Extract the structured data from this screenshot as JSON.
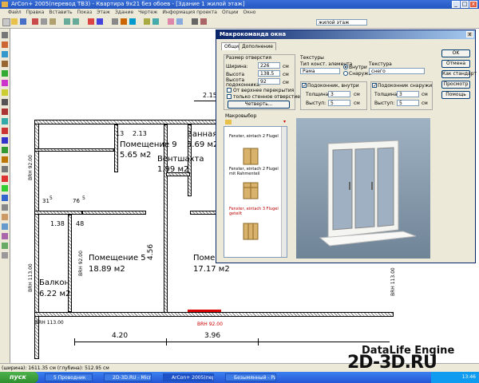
{
  "window": {
    "title": "ArCon+ 2005(перевод TB3) - Квартира 9х21 без обоев - [Здание 1 жилой этаж]"
  },
  "menu": [
    "Файл",
    "Правка",
    "Вставить",
    "Показ",
    "Этаж",
    "Здание",
    "Чертеж",
    "Информация проекта",
    "Опции",
    "Окно"
  ],
  "toolbar": {
    "floor_select": "жилой этаж"
  },
  "plan": {
    "rooms": [
      {
        "name": "Помещение 9",
        "area": "5.65 м2"
      },
      {
        "name": "Ванная",
        "area": "5.69 м2"
      },
      {
        "name": "Вентшахта",
        "area": "1.99 м2"
      },
      {
        "name": "Помещение 5",
        "area": "18.89 м2"
      },
      {
        "name": "Помеще",
        "area": "17.17 м2"
      },
      {
        "name": "Балкон",
        "area": "6.22 м2"
      }
    ],
    "dims": {
      "d215": "2.15",
      "d213": "2.13",
      "d13": "13",
      "d76": "76",
      "d5": "5",
      "d31": "31",
      "d138": "1.38",
      "d48": "48",
      "d456": "4.56",
      "d420": "4.20",
      "d396": "3.96"
    },
    "labels": {
      "brh_top": "BRH 92.00",
      "brh_left": "BRH 113.00",
      "brh_bottom": "BRH 113.00",
      "brh_mid": "BRH 92.00",
      "brh_mid2": "BRH 92.00",
      "brh_right": "BRH 113.00"
    }
  },
  "dialog": {
    "title": "Макрокоманда окна",
    "tabs": [
      "Общие",
      "Дополнение"
    ],
    "size_group": {
      "title": "Размер отверстия",
      "width_label": "Ширина:",
      "width_value": "226",
      "width_unit": "см",
      "height_label": "Высота",
      "height_value": "138.5",
      "height_unit": "см",
      "sill_label": "Высота подоконника:",
      "sill_value": "92",
      "sill_unit": "см",
      "check1": "От верхнее перекрытия",
      "check2": "только стенное отверстие",
      "quarter_button": "Четверть..."
    },
    "textures": {
      "title": "Текстуры",
      "elem_label": "Тип конст. элемента",
      "elem_value": "Рама",
      "inside": "Внутри",
      "outside": "Снаружи",
      "texture_label": "Текстура",
      "texture_value": "снего"
    },
    "sill_inside": {
      "label": "Подоконник, внутри",
      "thickness_label": "Толщина:",
      "thickness": "3",
      "thickness_unit": "см",
      "protrusion_label": "Выступ:",
      "protrusion": "5",
      "protrusion_unit": "см"
    },
    "sill_outside": {
      "label": "Подоконник снаружи",
      "thickness_label": "Толщина:",
      "thickness": "3",
      "thickness_unit": "см",
      "protrusion_label": "Выступ:",
      "protrusion": "5",
      "protrusion_unit": "см"
    },
    "buttons": {
      "ok": "OK",
      "cancel": "Отмена",
      "as_standard": "Как стандарт",
      "preview": "Просмотр",
      "help": "Помощь"
    },
    "macro": {
      "title": "Макровыбор",
      "items": [
        "Fenster, eintach 2 Flugel",
        "Fenster, eintach 2 Flugel mit Rahmenteil",
        "Fenster, eintach 3 Flugel geteilt"
      ]
    }
  },
  "status": {
    "text": "(ширина): 1611.35 см (глубина): 512.95 см"
  },
  "taskbar": {
    "start": "пуск",
    "tasks": [
      "5 Проводник",
      "2D-3D.RU - Microsoft ...",
      "ArCon+ 2005(перевод...",
      "Безымянный - Paint"
    ],
    "tray_time": "13:46"
  },
  "watermark": {
    "line1": "DataLife Engine",
    "line2": "2D-3D.RU"
  }
}
